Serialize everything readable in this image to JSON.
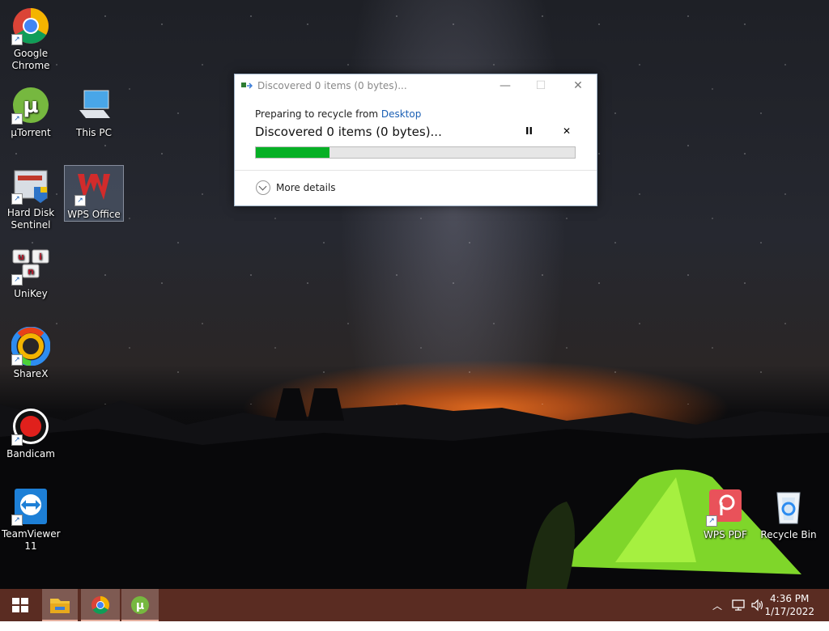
{
  "desktop_icons": [
    {
      "id": "chrome",
      "label": "Google Chrome",
      "icon": "chrome-icon"
    },
    {
      "id": "utorrent",
      "label": "µTorrent",
      "icon": "utorrent-icon"
    },
    {
      "id": "thispc",
      "label": "This PC",
      "icon": "computer-icon"
    },
    {
      "id": "hds",
      "label": "Hard Disk Sentinel",
      "icon": "hard-disk-icon"
    },
    {
      "id": "wps",
      "label": "WPS Office",
      "icon": "wps-office-icon"
    },
    {
      "id": "unikey",
      "label": "UniKey",
      "icon": "unikey-icon"
    },
    {
      "id": "sharex",
      "label": "ShareX",
      "icon": "sharex-icon"
    },
    {
      "id": "bandicam",
      "label": "Bandicam",
      "icon": "bandicam-icon"
    },
    {
      "id": "teamviewer",
      "label": "TeamViewer 11",
      "icon": "teamviewer-icon"
    },
    {
      "id": "wpspdf",
      "label": "WPS PDF",
      "icon": "wps-pdf-icon"
    },
    {
      "id": "recycle",
      "label": "Recycle Bin",
      "icon": "recycle-bin-icon"
    }
  ],
  "dialog": {
    "title": "Discovered 0 items (0 bytes)...",
    "prep_text": "Preparing to recycle from ",
    "prep_link": "Desktop",
    "status": "Discovered 0 items (0 bytes)...",
    "pause_label": "II",
    "cancel_label": "✕",
    "progress": 0.23,
    "more_details": "More details",
    "minimize": "—",
    "maximize": "☐",
    "close": "✕"
  },
  "taskbar": {
    "time": "4:36 PM",
    "date": "1/17/2022",
    "tray_up": "︿"
  },
  "colors": {
    "taskbar": "#5a2c22",
    "progress": "#06b025",
    "link": "#1a5fb4"
  }
}
